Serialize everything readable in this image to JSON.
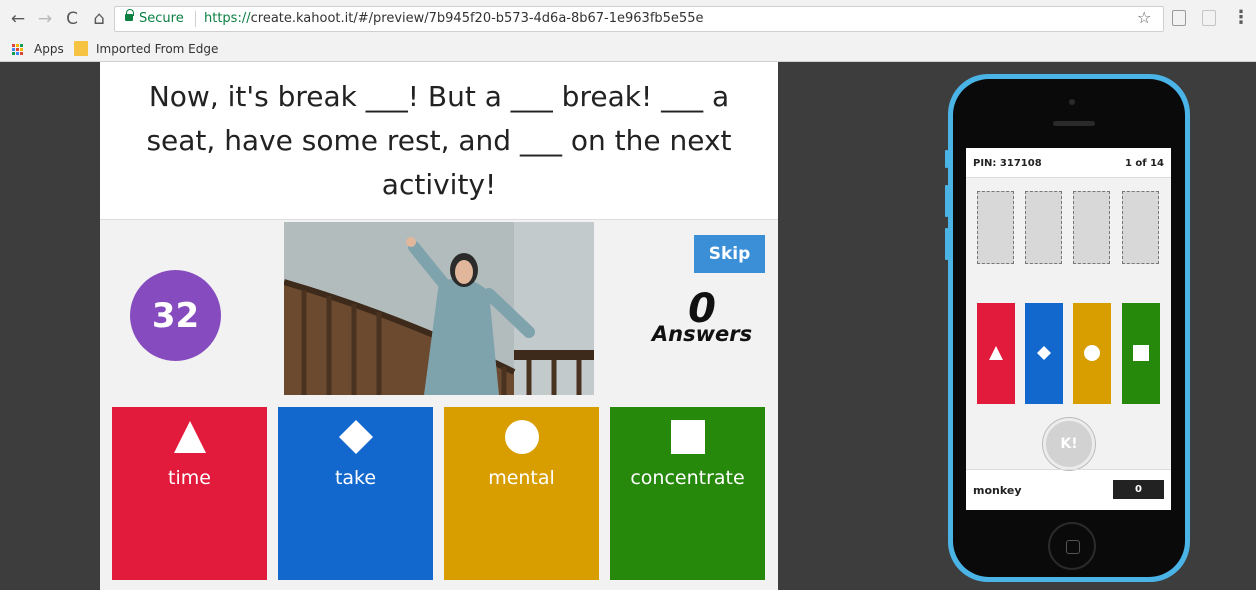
{
  "browser": {
    "secure_label": "Secure",
    "url_scheme": "https://",
    "url_rest": "create.kahoot.it/#/preview/7b945f20-b573-4d6a-8b67-1e963fb5e55e",
    "bookmarks": [
      {
        "label": "Apps"
      },
      {
        "label": "Imported From Edge"
      }
    ],
    "icons": {
      "back": "←",
      "forward": "→",
      "reload": "C",
      "home": "⌂",
      "star": "☆",
      "menu": "⋮"
    }
  },
  "game": {
    "question": "Now, it's break ___! But a ___ break! ___ a seat, have some rest, and ___ on the next activity!",
    "timer": "32",
    "skip_label": "Skip",
    "answer_count": "0",
    "answer_count_label": "Answers",
    "answers": [
      {
        "label": "time",
        "shape": "triangle-icon",
        "color": "#e21b3c"
      },
      {
        "label": "take",
        "shape": "diamond-icon",
        "color": "#1368ce"
      },
      {
        "label": "mental",
        "shape": "circle-icon",
        "color": "#d89e00"
      },
      {
        "label": "concentrate",
        "shape": "square-icon",
        "color": "#26890c"
      }
    ]
  },
  "phone": {
    "pin": "PIN: 317108",
    "progress": "1 of 14",
    "k_label": "K!",
    "nickname": "monkey",
    "score": "0"
  }
}
